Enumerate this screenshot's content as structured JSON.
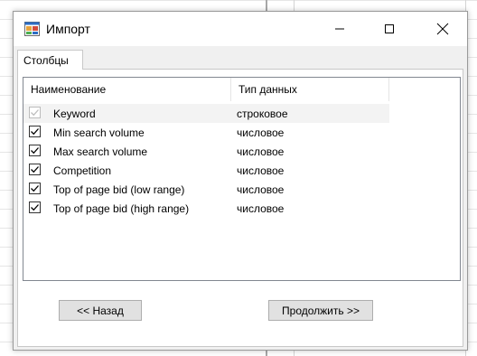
{
  "window": {
    "title": "Импорт",
    "controls": {
      "minimize": "–",
      "maximize": "□",
      "close": "✕"
    }
  },
  "tabs": [
    {
      "label": "Столбцы",
      "selected": true
    }
  ],
  "columns_list": {
    "headers": {
      "name": "Наименование",
      "type": "Тип данных"
    },
    "rows": [
      {
        "name": "Keyword",
        "type": "строковое",
        "checked": true,
        "enabled": false
      },
      {
        "name": "Min search volume",
        "type": "числовое",
        "checked": true,
        "enabled": true
      },
      {
        "name": "Max search volume",
        "type": "числовое",
        "checked": true,
        "enabled": true
      },
      {
        "name": "Competition",
        "type": "числовое",
        "checked": true,
        "enabled": true
      },
      {
        "name": "Top of page bid (low range)",
        "type": "числовое",
        "checked": true,
        "enabled": true
      },
      {
        "name": "Top of page bid (high range)",
        "type": "числовое",
        "checked": true,
        "enabled": true
      }
    ]
  },
  "buttons": {
    "back": "<< Назад",
    "next": "Продолжить >>"
  },
  "icons": {
    "app": "app-window-icon",
    "check": "check-icon"
  },
  "colors": {
    "window_bg": "#f0f0f0",
    "titlebar": "#ffffff",
    "button": "#e1e1e1",
    "disabled_check": "#bcbcbc"
  }
}
